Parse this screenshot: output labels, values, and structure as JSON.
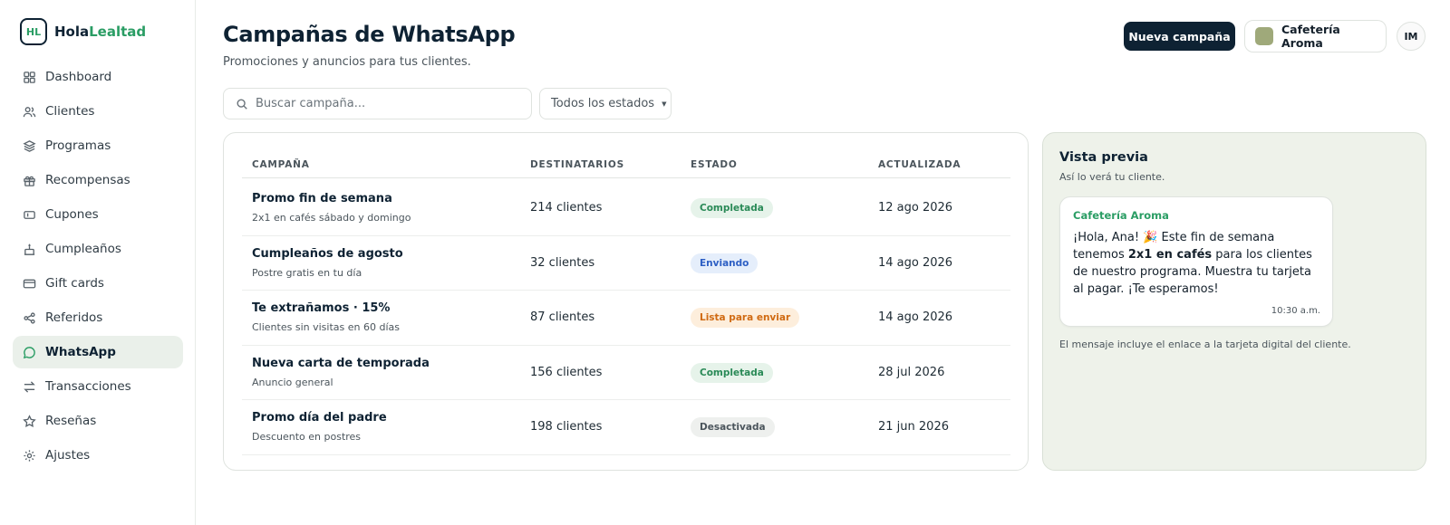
{
  "brand": {
    "mark": "HL",
    "name_part1": "Hola",
    "name_part2": "Lealtad",
    "accent_color": "#2a9d64"
  },
  "sidebar": {
    "items": [
      {
        "label": "Dashboard",
        "icon": "grid-icon"
      },
      {
        "label": "Clientes",
        "icon": "users-icon"
      },
      {
        "label": "Programas",
        "icon": "layers-icon"
      },
      {
        "label": "Recompensas",
        "icon": "gift-icon"
      },
      {
        "label": "Cupones",
        "icon": "ticket-icon"
      },
      {
        "label": "Cumpleaños",
        "icon": "cake-icon"
      },
      {
        "label": "Gift cards",
        "icon": "card-icon"
      },
      {
        "label": "Referidos",
        "icon": "share-icon"
      },
      {
        "label": "WhatsApp",
        "icon": "chat-icon",
        "active": true
      },
      {
        "label": "Transacciones",
        "icon": "arrows-icon"
      },
      {
        "label": "Reseñas",
        "icon": "star-icon"
      },
      {
        "label": "Ajustes",
        "icon": "gear-icon"
      }
    ]
  },
  "header": {
    "title": "Campañas de WhatsApp",
    "subtitle": "Promociones y anuncios para tus clientes.",
    "new_campaign_label": "Nueva campaña",
    "business_name": "Cafetería Aroma",
    "avatar_initials": "IM"
  },
  "filters": {
    "search_placeholder": "Buscar campaña...",
    "status_selected": "Todos los estados"
  },
  "table": {
    "headers": {
      "campaign": "CAMPAÑA",
      "recipients": "DESTINATARIOS",
      "status": "ESTADO",
      "updated": "ACTUALIZADA"
    },
    "rows": [
      {
        "name": "Promo fin de semana",
        "desc": "2x1 en cafés sábado y domingo",
        "recipients": "214 clientes",
        "status": "Completada",
        "status_kind": "completed",
        "updated": "12 ago 2026"
      },
      {
        "name": "Cumpleaños de agosto",
        "desc": "Postre gratis en tu día",
        "recipients": "32 clientes",
        "status": "Enviando",
        "status_kind": "sending",
        "updated": "14 ago 2026"
      },
      {
        "name": "Te extrañamos · 15%",
        "desc": "Clientes sin visitas en 60 días",
        "recipients": "87 clientes",
        "status": "Lista para enviar",
        "status_kind": "ready",
        "updated": "14 ago 2026"
      },
      {
        "name": "Nueva carta de temporada",
        "desc": "Anuncio general",
        "recipients": "156 clientes",
        "status": "Completada",
        "status_kind": "completed",
        "updated": "28 jul 2026"
      },
      {
        "name": "Promo día del padre",
        "desc": "Descuento en postres",
        "recipients": "198 clientes",
        "status": "Desactivada",
        "status_kind": "disabled",
        "updated": "21 jun 2026"
      }
    ]
  },
  "preview": {
    "title": "Vista previa",
    "subtitle": "Así lo verá tu cliente.",
    "sender": "Cafetería Aroma",
    "message_part1": "¡Hola, Ana! 🎉 Este fin de semana tenemos ",
    "message_bold": "2x1 en cafés",
    "message_part2": " para los clientes de nuestro programa. Muestra tu tarjeta al pagar. ¡Te esperamos!",
    "time": "10:30 a.m.",
    "note": "El mensaje incluye el enlace a la tarjeta digital del cliente."
  }
}
